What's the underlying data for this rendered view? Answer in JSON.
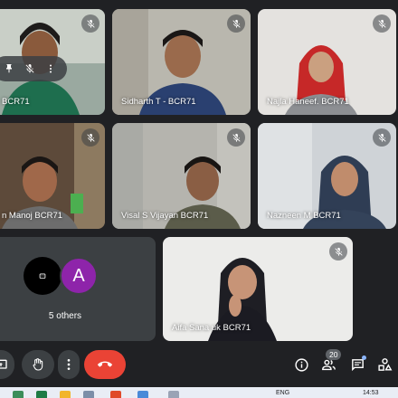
{
  "participants": [
    {
      "name": "BCR71",
      "muted": true
    },
    {
      "name": "Sidharth T - BCR71",
      "muted": true
    },
    {
      "name": "Najla Haneef. BCR71",
      "muted": true
    },
    {
      "name": "n Manoj BCR71",
      "muted": true
    },
    {
      "name": "Visal S Vijayan BCR71",
      "muted": true
    },
    {
      "name": "Nazneen M BCR71",
      "muted": true
    },
    {
      "name": "Aifa Sana uk BCR71",
      "muted": true
    }
  ],
  "others": {
    "label": "5 others",
    "avatar_letter": "A",
    "avatar_color": "#8e24aa"
  },
  "toolbar": {
    "participant_count": "20"
  },
  "taskbar": {
    "lang": "ENG",
    "time": "14:53"
  },
  "icons": [
    "mic-off-icon",
    "pin-icon",
    "more-vert-icon",
    "present-icon",
    "raise-hand-icon",
    "end-call-icon",
    "info-icon",
    "people-icon",
    "chat-icon",
    "activities-icon"
  ],
  "colors": {
    "background": "#202124",
    "tile": "#3c4043",
    "end_call": "#ea4335"
  }
}
